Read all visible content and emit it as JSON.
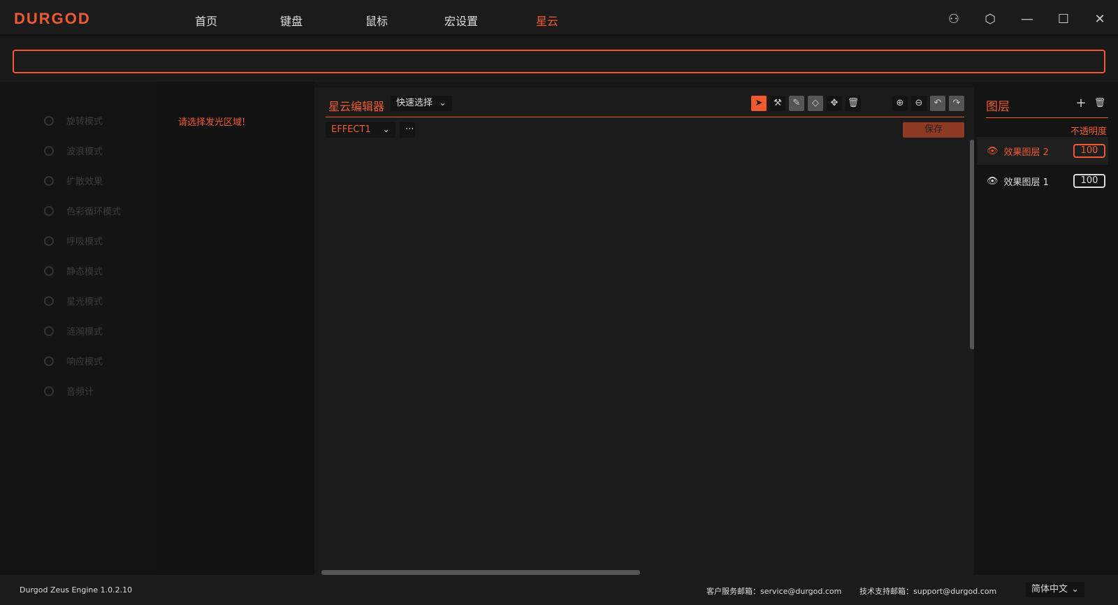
{
  "header": {
    "logo": "DURGOD",
    "nav": [
      "首页",
      "键盘",
      "鼠标",
      "宏设置",
      "星云"
    ],
    "active_nav": "星云"
  },
  "modes": [
    "旋转模式",
    "波浪模式",
    "扩散效果",
    "色彩循环模式",
    "呼吸模式",
    "静态模式",
    "星光模式",
    "涟漪模式",
    "响应模式",
    "音频计"
  ],
  "hint": "请选择发光区域!",
  "editor": {
    "title": "星云编辑器",
    "select_mode": "快速选择",
    "effect": "EFFECT1",
    "more": "···",
    "save": "保存"
  },
  "layers": {
    "title": "图层",
    "opacity_label": "不透明度",
    "items": [
      {
        "name": "效果图层 2",
        "opacity": "100",
        "active": true
      },
      {
        "name": "效果图层 1",
        "opacity": "100",
        "active": false
      }
    ]
  },
  "footer": {
    "version": "Durgod Zeus Engine 1.0.2.10",
    "service": "客户服务邮箱：service@durgod.com",
    "support": "技术支持邮箱：support@durgod.com",
    "language": "简体中文"
  },
  "colors": {
    "accent": "#f05a2f"
  }
}
